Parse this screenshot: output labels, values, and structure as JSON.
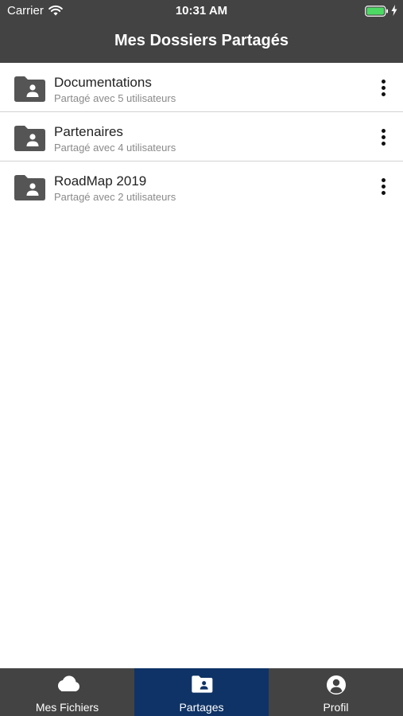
{
  "status_bar": {
    "carrier": "Carrier",
    "time": "10:31 AM",
    "battery_color": "#4cd964"
  },
  "header": {
    "title": "Mes Dossiers Partagés",
    "background": "#434343"
  },
  "folders": [
    {
      "name": "Documentations",
      "subtitle": "Partagé avec 5 utilisateurs",
      "icon": "shared-folder-icon"
    },
    {
      "name": "Partenaires",
      "subtitle": "Partagé avec 4 utilisateurs",
      "icon": "shared-folder-icon"
    },
    {
      "name": "RoadMap 2019",
      "subtitle": "Partagé avec 2 utilisateurs",
      "icon": "shared-folder-icon"
    }
  ],
  "tabbar": {
    "active_color": "#0f3366",
    "tabs": [
      {
        "label": "Mes Fichiers",
        "icon": "cloud-icon",
        "active": false
      },
      {
        "label": "Partages",
        "icon": "shared-folder-icon",
        "active": true
      },
      {
        "label": "Profil",
        "icon": "user-circle-icon",
        "active": false
      }
    ]
  }
}
